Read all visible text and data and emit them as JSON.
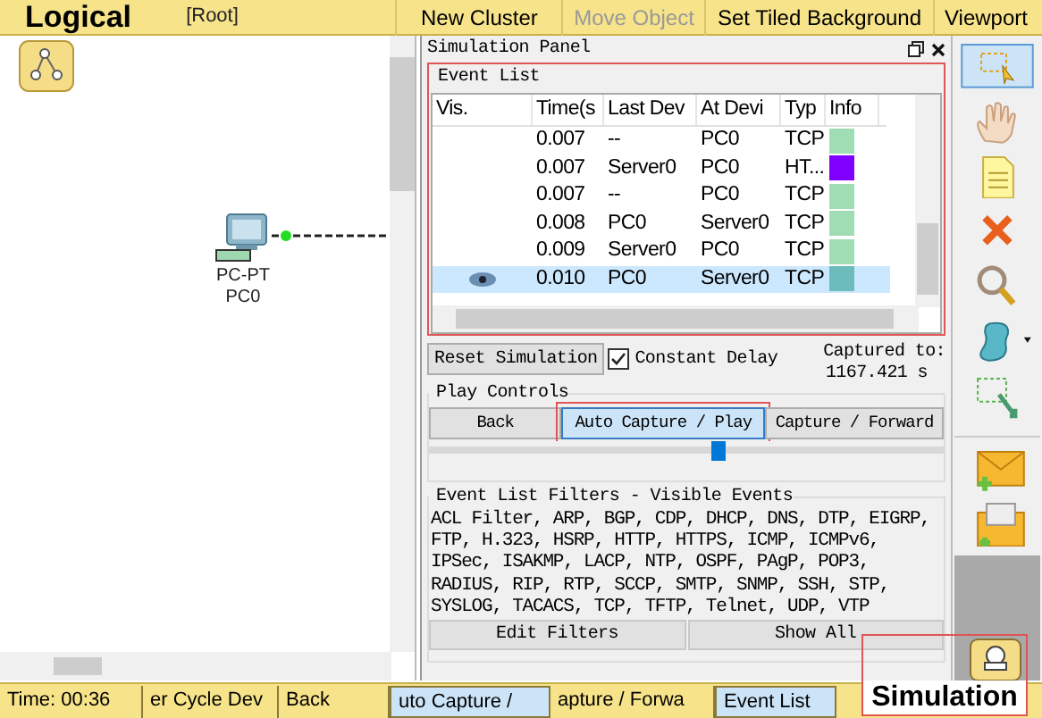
{
  "top_bar": {
    "title": "Logical",
    "path": "[Root]",
    "actions": [
      {
        "label": "New Cluster",
        "disabled": false
      },
      {
        "label": "Move Object",
        "disabled": true
      },
      {
        "label": "Set Tiled Background",
        "disabled": false
      },
      {
        "label": "Viewport",
        "disabled": false
      }
    ]
  },
  "canvas": {
    "device": {
      "model": "PC-PT",
      "name": "PC0"
    }
  },
  "simulation_panel": {
    "title": "Simulation Panel",
    "event_list": {
      "title": "Event List",
      "columns": [
        "Vis.",
        "Time(s",
        "Last Dev",
        "At Devi",
        "Typ",
        "Info"
      ],
      "rows": [
        {
          "visible": false,
          "time": "0.007",
          "last_device": "--",
          "at_device": "PC0",
          "type": "TCP",
          "color": "#a0dcb4",
          "selected": false
        },
        {
          "visible": false,
          "time": "0.007",
          "last_device": "Server0",
          "at_device": "PC0",
          "type": "HT...",
          "color": "#8000ff",
          "selected": false
        },
        {
          "visible": false,
          "time": "0.007",
          "last_device": "--",
          "at_device": "PC0",
          "type": "TCP",
          "color": "#a0dcb4",
          "selected": false
        },
        {
          "visible": false,
          "time": "0.008",
          "last_device": "PC0",
          "at_device": "Server0",
          "type": "TCP",
          "color": "#a0dcb4",
          "selected": false
        },
        {
          "visible": false,
          "time": "0.009",
          "last_device": "Server0",
          "at_device": "PC0",
          "type": "TCP",
          "color": "#a0dcb4",
          "selected": false
        },
        {
          "visible": true,
          "time": "0.010",
          "last_device": "PC0",
          "at_device": "Server0",
          "type": "TCP",
          "color": "#6cbcbc",
          "selected": true
        }
      ]
    },
    "reset_button": "Reset Simulation",
    "constant_delay": {
      "label": "Constant Delay",
      "checked": true
    },
    "captured_label": "Captured to:",
    "captured_value": "1167.421 s",
    "play_controls": {
      "title": "Play Controls",
      "buttons": [
        {
          "label": "Back",
          "selected": false
        },
        {
          "label": "Auto Capture / Play",
          "selected": true
        },
        {
          "label": "Capture / Forward",
          "selected": false
        }
      ],
      "level": 0.55
    },
    "filters": {
      "title": "Event List Filters - Visible Events",
      "text": "ACL Filter, ARP, BGP, CDP, DHCP, DNS, DTP, EIGRP, FTP, H.323, HSRP, HTTP, HTTPS, ICMP, ICMPv6, IPSec, ISAKMP, LACP, NTP, OSPF, PAgP, POP3, RADIUS, RIP, RTP, SCCP, SMTP, SNMP, SSH, STP, SYSLOG, TACACS, TCP, TFTP, Telnet, UDP, VTP",
      "buttons": [
        "Edit Filters",
        "Show All"
      ]
    }
  },
  "status_bar": [
    {
      "label": "Time: 00:36",
      "selected": false
    },
    {
      "label": "er Cycle Dev",
      "selected": false
    },
    {
      "label": "Back",
      "selected": false
    },
    {
      "label": "uto Capture /",
      "selected": true
    },
    {
      "label": "apture / Forwa",
      "selected": false
    },
    {
      "label": "Event List",
      "selected": true
    }
  ],
  "mode_tab": "Simulation"
}
